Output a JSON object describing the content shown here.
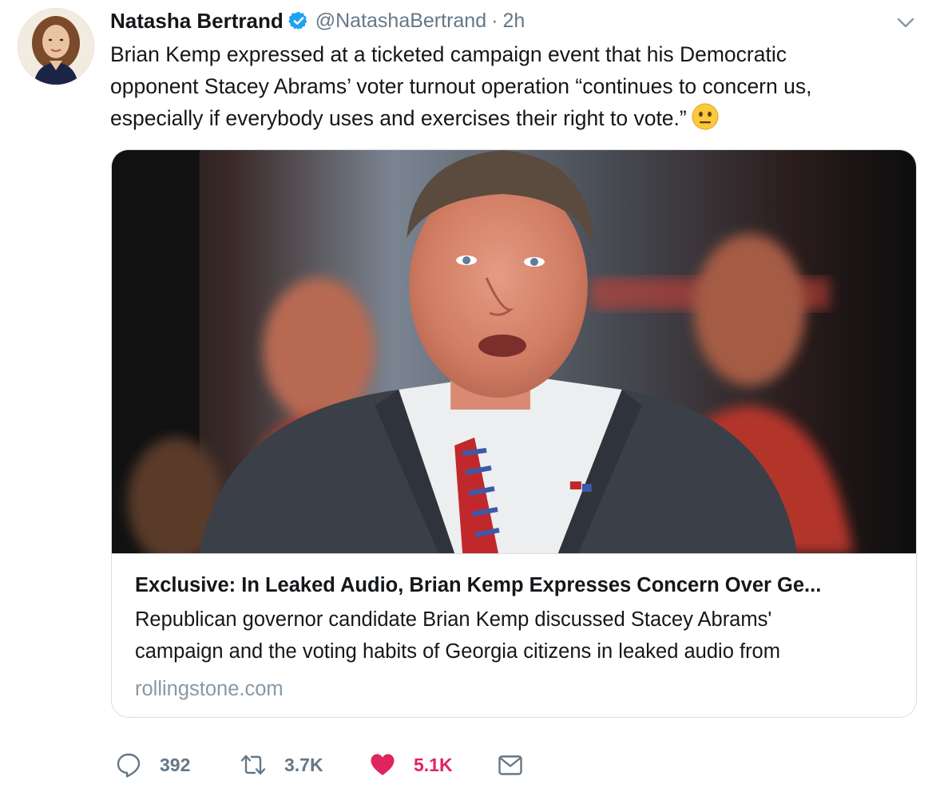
{
  "tweet": {
    "author": {
      "display_name": "Natasha Bertrand",
      "handle": "@NatashaBertrand",
      "verified": true
    },
    "separator": "·",
    "time": "2h",
    "text_lines": [
      "Brian Kemp expressed at a ticketed campaign event that his Democratic",
      "opponent Stacey Abrams’ voter turnout operation “continues to concern us,",
      "especially if everybody uses and exercises their right to vote.”"
    ],
    "emoji": "neutral-face-emoji",
    "card": {
      "title": "Exclusive: In Leaked Audio, Brian Kemp Expresses Concern Over Ge...",
      "description_lines": [
        "Republican governor candidate Brian Kemp discussed Stacey Abrams'",
        "campaign and the voting habits of Georgia citizens in leaked audio from"
      ],
      "domain": "rollingstone.com"
    },
    "actions": {
      "replies": "392",
      "retweets": "3.7K",
      "likes": "5.1K"
    }
  },
  "colors": {
    "text": "#14171a",
    "secondary": "#657786",
    "verified_blue": "#1da1f2",
    "like_red": "#e0245e",
    "card_border": "#d8dee3",
    "domain_gray": "#8899a6"
  }
}
